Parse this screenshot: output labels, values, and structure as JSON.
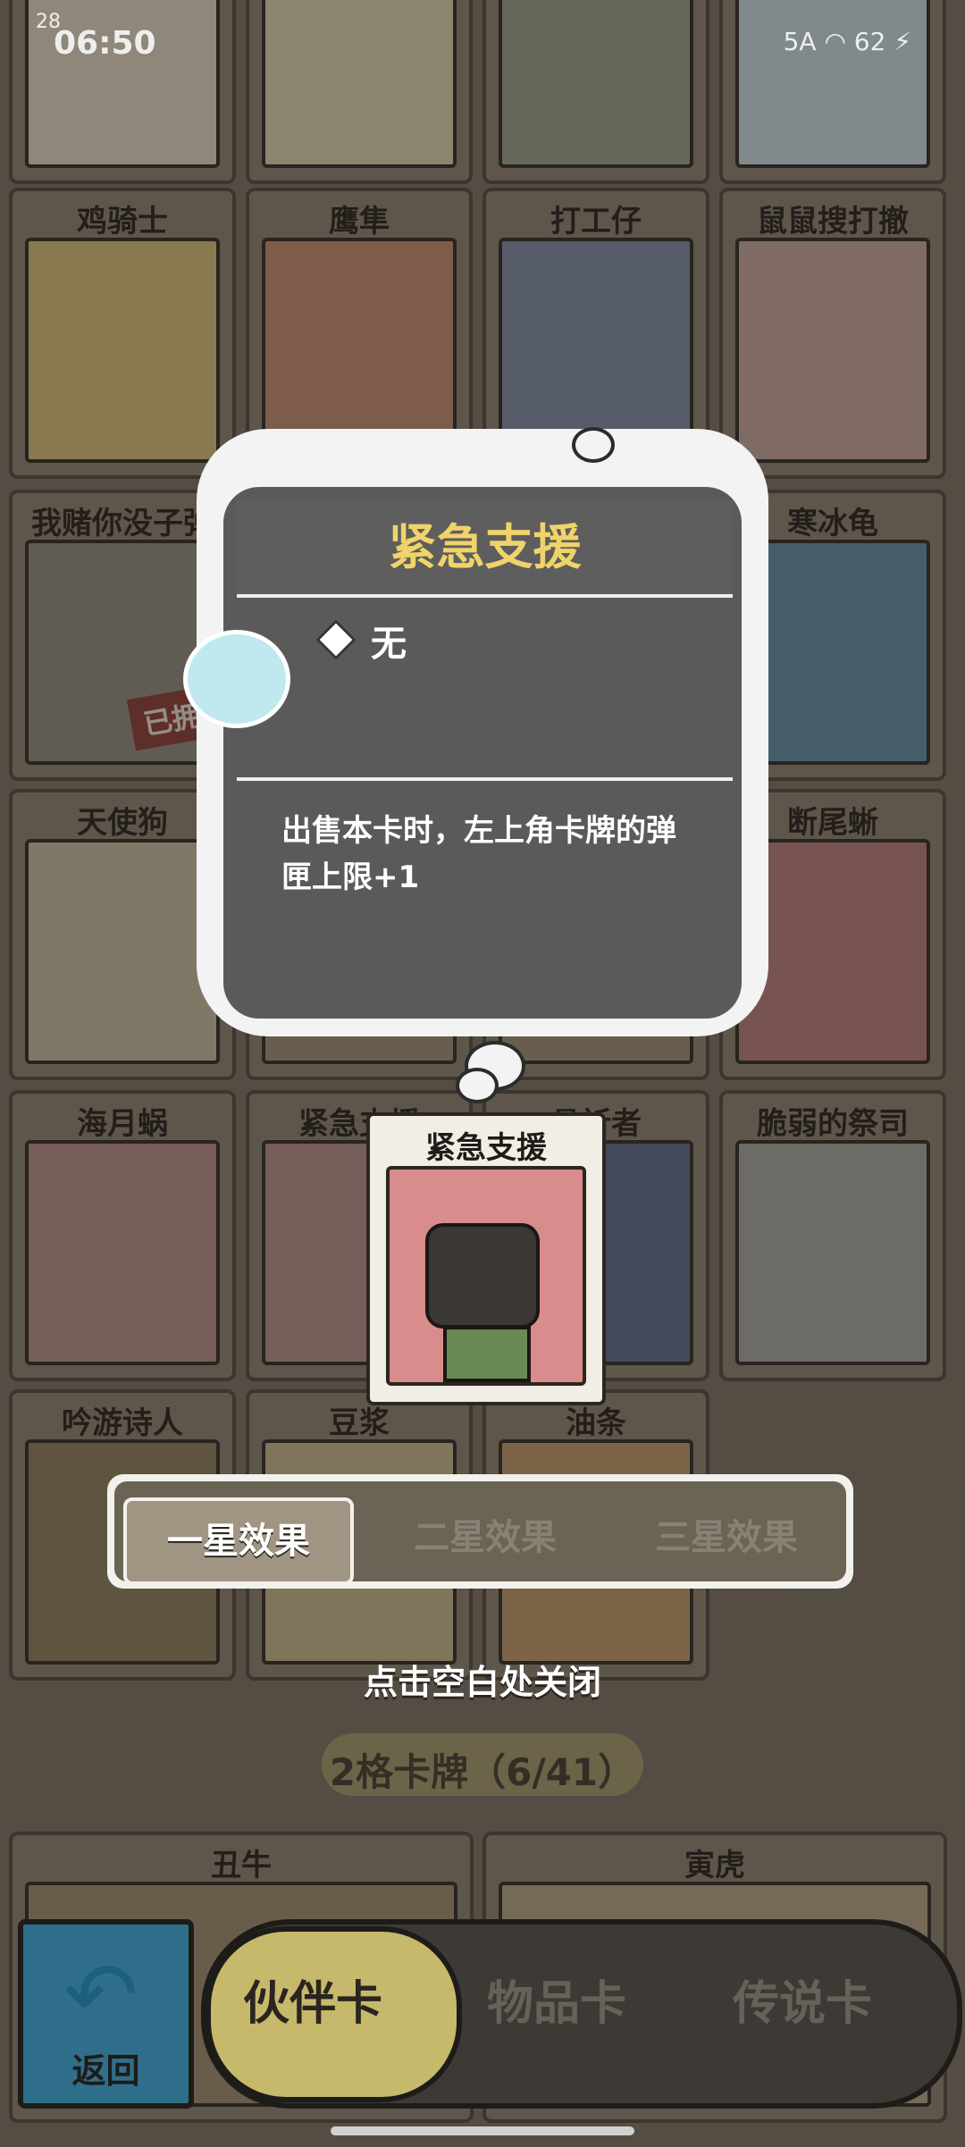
{
  "status": {
    "time": "06:50",
    "indicator": "28",
    "battery": "62",
    "network": "5A"
  },
  "grid": {
    "row0": [
      "",
      "",
      "",
      ""
    ],
    "row1": [
      "鸡骑士",
      "鹰隼",
      "打工仔",
      "鼠鼠搜打撤"
    ],
    "row2": [
      "我赌你没子弹",
      "",
      "",
      "寒冰龟"
    ],
    "row3": [
      "天使狗",
      "",
      "",
      "断尾蜥"
    ],
    "row4": [
      "海月蜗",
      "紧急支援",
      "悬祈者",
      "脆弱的祭司"
    ],
    "row5": [
      "吟游诗人",
      "豆浆",
      "油条"
    ],
    "owned_badge": "已拥有",
    "bottom_row": [
      "丑牛",
      "寅虎"
    ]
  },
  "popup": {
    "title": "紧急支援",
    "ammo_value": "无",
    "description": "出售本卡时，左上角卡牌的弹匣上限+1"
  },
  "card_preview": {
    "name": "紧急支援"
  },
  "star_tabs": {
    "tabs": [
      "一星效果",
      "二星效果",
      "三星效果"
    ],
    "active": 0
  },
  "close_hint": "点击空白处关闭",
  "section": {
    "title": "2格卡牌（6/41）"
  },
  "nav": {
    "back_label": "返回",
    "tabs": [
      "伙伴卡",
      "物品卡",
      "传说卡"
    ],
    "active": 0
  },
  "colors": {
    "accent_yellow": "#f0d36a",
    "popup_gray": "#5a5a5a",
    "nav_active": "#c7b96b"
  }
}
